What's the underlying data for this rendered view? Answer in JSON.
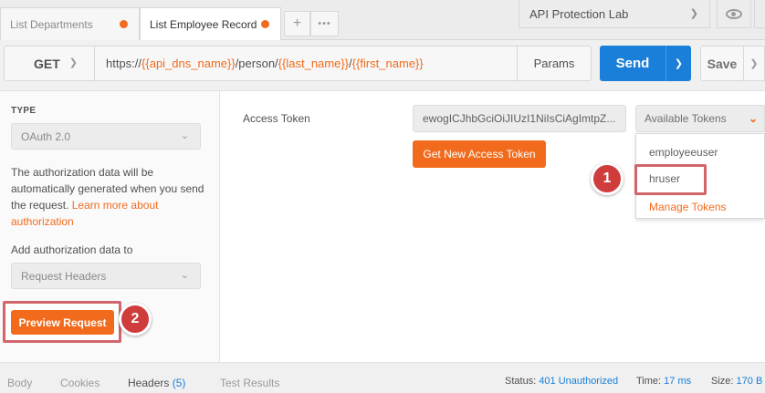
{
  "tabs": [
    {
      "label": "List Departments"
    },
    {
      "label": "List Employee Record"
    }
  ],
  "tab_add_label": "+",
  "tab_more_label": "•••",
  "environment": {
    "label": "API Protection Lab"
  },
  "request": {
    "method": "GET",
    "url_parts": [
      "https://",
      "{{api_dns_name}}",
      "/person/",
      "{{last_name}}",
      "/",
      "{{first_name}}"
    ],
    "params_label": "Params",
    "send_label": "Send",
    "save_label": "Save"
  },
  "auth": {
    "type_label": "TYPE",
    "type_value": "OAuth 2.0",
    "description": "The authorization data will be automatically generated when you send the request.",
    "learn_more": "Learn more about authorization",
    "add_to_label": "Add authorization data to",
    "add_to_value": "Request Headers",
    "preview_label": "Preview Request"
  },
  "token": {
    "label": "Access Token",
    "value": "ewogICJhbGciOiJIUzI1NiIsCiAgImtpZ...",
    "available_label": "Available Tokens",
    "get_new_label": "Get New Access Token",
    "options": [
      "employeeuser",
      "hruser"
    ],
    "manage_label": "Manage Tokens"
  },
  "callouts": {
    "one": "1",
    "two": "2"
  },
  "bottom": {
    "tabs": [
      {
        "label": "Body"
      },
      {
        "label": "Cookies"
      },
      {
        "label": "Headers",
        "count": "(5)"
      },
      {
        "label": "Test Results"
      }
    ],
    "status_label": "Status:",
    "status_value": "401 Unauthorized",
    "time_label": "Time:",
    "time_value": "17 ms",
    "size_label": "Size:",
    "size_value": "170 B"
  },
  "colors": {
    "accent": "#f26b1d",
    "primary": "#1a7fd8",
    "callout": "#cf3c3c"
  }
}
